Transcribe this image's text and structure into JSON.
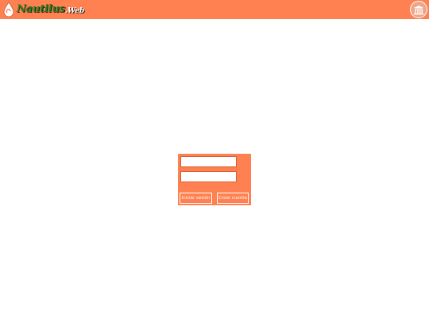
{
  "app": {
    "logo_text": "Nautilus",
    "logo_suffix": ".Web",
    "brand_color": "#ff8051",
    "logo_icon": "nautilus-drop-icon",
    "top_right_icon": "building-icon"
  },
  "login": {
    "username": {
      "value": "",
      "placeholder": ""
    },
    "password": {
      "value": "",
      "placeholder": ""
    },
    "login_label": "Iniciar sesión",
    "signup_label": "Crear cuenta"
  }
}
